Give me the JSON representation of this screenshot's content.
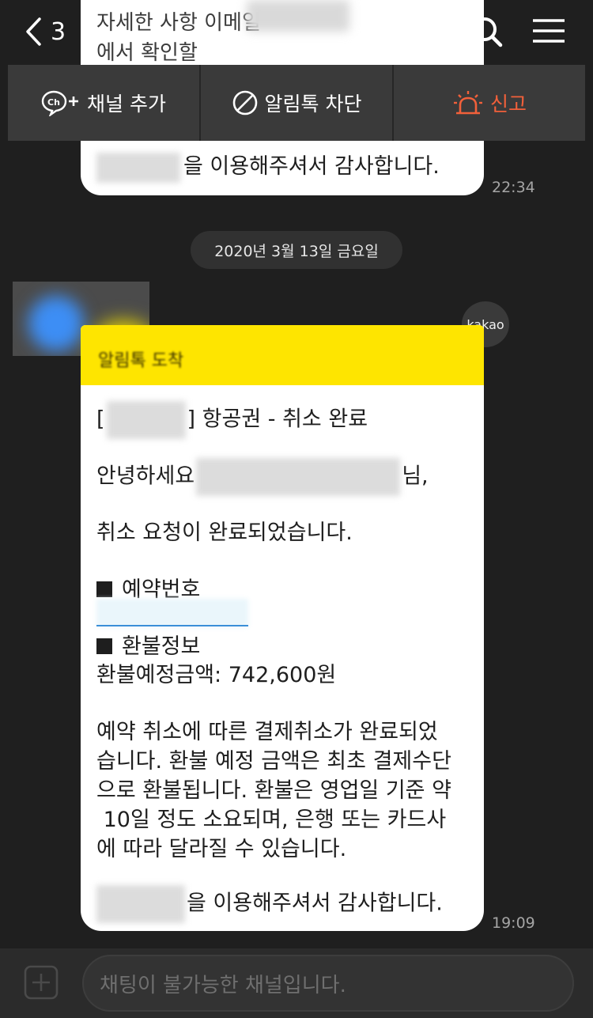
{
  "header": {
    "back_count": "3",
    "search_icon": "search-icon",
    "menu_icon": "hamburger-menu-icon"
  },
  "previous_message": {
    "line1": "자세한 사항                           이메일",
    "line2": "에서 확인할",
    "thanks_text": "을 이용해주셔서 감사합니다.",
    "time": "22:34"
  },
  "action_bar": {
    "add_channel_label": "채널 추가",
    "block_label": "알림톡 차단",
    "report_label": "신고",
    "report_color": "#f2603a"
  },
  "date_divider": "2020년 3월 13일 금요일",
  "sender_badge": "kakao",
  "message": {
    "header_title": "알림톡 도착",
    "header_color": "#fee500",
    "title_suffix": "] 항공권 - 취소 완료",
    "title_prefix": "[",
    "greeting_prefix": "안녕하세요",
    "greeting_suffix": "님,",
    "cancel_done": "취소 요청이 완료되었습니다.",
    "reservation_label": "예약번호",
    "refund_label": "환불정보",
    "refund_amount": "환불예정금액: 742,600원",
    "body_lines": [
      "예약 취소에 따른 결제취소가 완료되었",
      "습니다. 환불 예정 금액은 최초 결제수단",
      "으로 환불됩니다. 환불은 영업일 기준 약",
      " 10일 정도 소요되며, 은행 또는 카드사",
      "에 따라 달라질 수 있습니다."
    ],
    "thanks_text": "을 이용해주셔서 감사합니다.",
    "time": "19:09"
  },
  "input": {
    "placeholder": "채팅이 불가능한 채널입니다."
  }
}
